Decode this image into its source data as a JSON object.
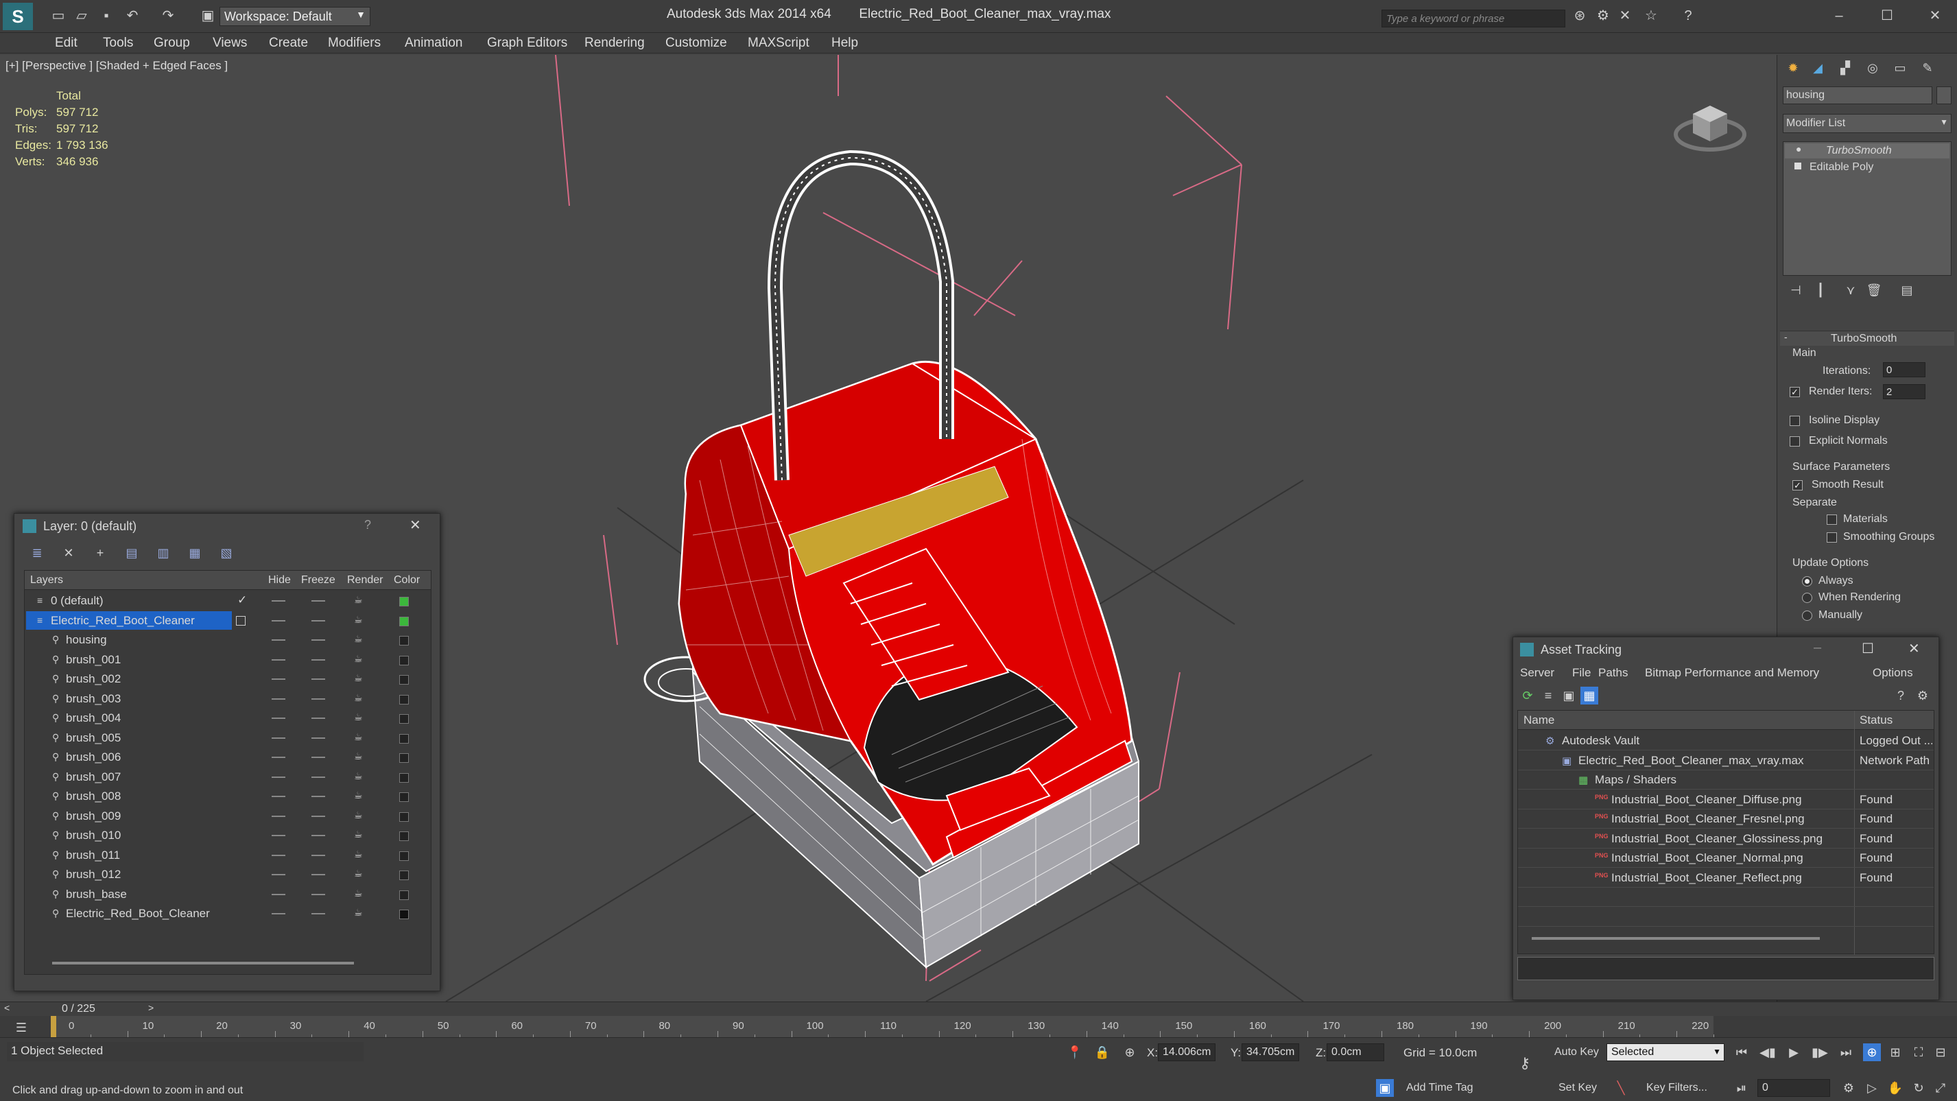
{
  "title": {
    "workspace": "Workspace: Default",
    "app": "Autodesk 3ds Max  2014 x64",
    "file": "Electric_Red_Boot_Cleaner_max_vray.max",
    "search_placeholder": "Type a keyword or phrase"
  },
  "menu": [
    "Edit",
    "Tools",
    "Group",
    "Views",
    "Create",
    "Modifiers",
    "Animation",
    "Graph Editors",
    "Rendering",
    "Customize",
    "MAXScript",
    "Help"
  ],
  "viewport": {
    "label": "[+] [Perspective ] [Shaded + Edged Faces ]",
    "stats_header": "Total",
    "stats": [
      {
        "label": "Polys:",
        "value": "597 712"
      },
      {
        "label": "Tris:",
        "value": "597 712"
      },
      {
        "label": "Edges:",
        "value": "1 793 136"
      },
      {
        "label": "Verts:",
        "value": "346 936"
      }
    ]
  },
  "command_panel": {
    "object_name": "housing",
    "modifier_list": "Modifier List",
    "stack": [
      "TurboSmooth",
      "Editable Poly"
    ],
    "rollout_title": "TurboSmooth",
    "main_label": "Main",
    "iterations_label": "Iterations:",
    "iterations_value": "0",
    "render_iters_label": "Render Iters:",
    "render_iters_value": "2",
    "isoline": "Isoline Display",
    "explicit_normals": "Explicit Normals",
    "surface_params": "Surface Parameters",
    "smooth_result": "Smooth Result",
    "separate": "Separate",
    "materials": "Materials",
    "smoothing_groups": "Smoothing Groups",
    "update_options": "Update Options",
    "always": "Always",
    "when_rendering": "When Rendering",
    "manually": "Manually"
  },
  "layer_dialog": {
    "title": "Layer: 0 (default)",
    "help": "?",
    "columns": [
      "Layers",
      "Hide",
      "Freeze",
      "Render",
      "Color"
    ],
    "rows": [
      {
        "name": "0 (default)",
        "color": "#3cb83c"
      },
      {
        "name": "Electric_Red_Boot_Cleaner",
        "color": "#3cb83c",
        "selected": true
      },
      {
        "name": "housing",
        "color": "#222222"
      },
      {
        "name": "brush_001",
        "color": "#222222"
      },
      {
        "name": "brush_002",
        "color": "#222222"
      },
      {
        "name": "brush_003",
        "color": "#222222"
      },
      {
        "name": "brush_004",
        "color": "#222222"
      },
      {
        "name": "brush_005",
        "color": "#222222"
      },
      {
        "name": "brush_006",
        "color": "#222222"
      },
      {
        "name": "brush_007",
        "color": "#222222"
      },
      {
        "name": "brush_008",
        "color": "#222222"
      },
      {
        "name": "brush_009",
        "color": "#222222"
      },
      {
        "name": "brush_010",
        "color": "#222222"
      },
      {
        "name": "brush_011",
        "color": "#222222"
      },
      {
        "name": "brush_012",
        "color": "#222222"
      },
      {
        "name": "brush_base",
        "color": "#222222"
      },
      {
        "name": "Electric_Red_Boot_Cleaner",
        "color": "#111111"
      }
    ]
  },
  "asset_dialog": {
    "title": "Asset Tracking",
    "menu": [
      "Server",
      "File",
      "Paths",
      "Bitmap Performance and Memory",
      "Options"
    ],
    "col_name": "Name",
    "col_status": "Status",
    "rows": [
      {
        "name": "Autodesk Vault",
        "status": "Logged Out ..."
      },
      {
        "name": "Electric_Red_Boot_Cleaner_max_vray.max",
        "status": "Network Path"
      },
      {
        "name": "Maps / Shaders",
        "status": ""
      },
      {
        "name": "Industrial_Boot_Cleaner_Diffuse.png",
        "status": "Found"
      },
      {
        "name": "Industrial_Boot_Cleaner_Fresnel.png",
        "status": "Found"
      },
      {
        "name": "Industrial_Boot_Cleaner_Glossiness.png",
        "status": "Found"
      },
      {
        "name": "Industrial_Boot_Cleaner_Normal.png",
        "status": "Found"
      },
      {
        "name": "Industrial_Boot_Cleaner_Reflect.png",
        "status": "Found"
      }
    ]
  },
  "timeline": {
    "frame": "0 / 225",
    "ticks": [
      "0",
      "10",
      "20",
      "30",
      "40",
      "50",
      "60",
      "70",
      "80",
      "90",
      "100",
      "110",
      "120",
      "130",
      "140",
      "150",
      "160",
      "170",
      "180",
      "190",
      "200",
      "210",
      "220"
    ]
  },
  "status": {
    "selected": "1 Object Selected",
    "hint": "Click and drag up-and-down to zoom in and out",
    "x_label": "X:",
    "x_value": "14.006cm",
    "y_label": "Y:",
    "y_value": "34.705cm",
    "z_label": "Z:",
    "z_value": "0.0cm",
    "grid": "Grid = 10.0cm",
    "auto_key": "Auto Key",
    "set_key": "Set Key",
    "selected_dropdown": "Selected",
    "key_filters": "Key Filters...",
    "add_time_tag": "Add Time Tag",
    "frame_field": "0"
  }
}
